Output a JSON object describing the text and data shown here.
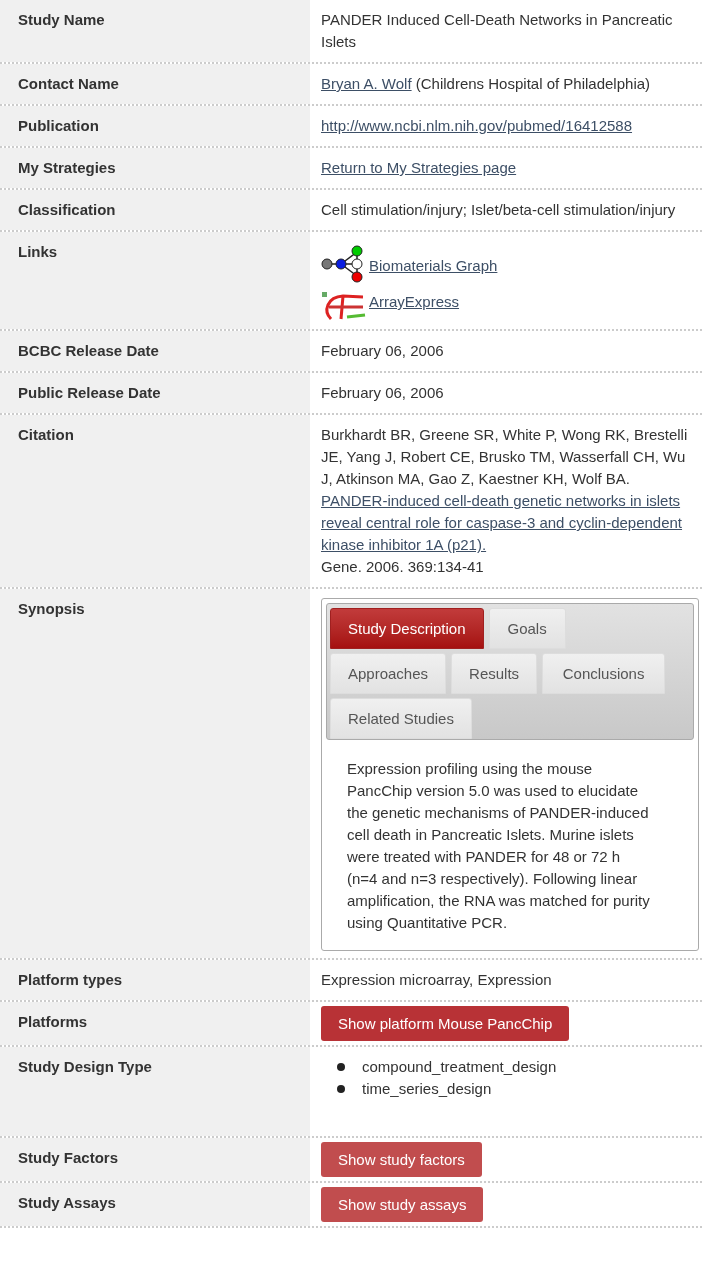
{
  "rows": [
    {
      "label": "Study Name",
      "kind": "text",
      "text": "PANDER Induced Cell-Death Networks in Pancreatic Islets"
    },
    {
      "label": "Contact Name",
      "kind": "contact",
      "link": "Bryan A. Wolf",
      "text": "(Childrens Hospital of Philadelphia)"
    },
    {
      "label": "Publication",
      "kind": "link",
      "link": "http://www.ncbi.nlm.nih.gov/pubmed/16412588"
    },
    {
      "label": "My Strategies",
      "kind": "link",
      "link": "Return to My Strategies page"
    },
    {
      "label": "Classification",
      "kind": "text",
      "text": "Cell stimulation/injury; Islet/beta-cell stimulation/injury"
    },
    {
      "label": "Links",
      "kind": "links",
      "items": [
        "Biomaterials Graph",
        "ArrayExpress"
      ]
    },
    {
      "label": "BCBC Release Date",
      "kind": "text",
      "text": "February 06, 2006"
    },
    {
      "label": "Public Release Date",
      "kind": "text",
      "text": "February 06, 2006"
    },
    {
      "label": "Citation",
      "kind": "citation",
      "before": "Burkhardt BR, Greene SR, White P, Wong RK, Brestelli JE, Yang J, Robert CE, Brusko TM, Wasserfall CH, Wu J, Atkinson MA, Gao Z, Kaestner KH, Wolf BA.",
      "link": "PANDER-induced cell-death genetic networks in islets reveal central role for caspase-3 and cyclin-dependent kinase inhibitor 1A (p21).",
      "after": "Gene. 2006. 369:134-41"
    },
    {
      "label": "Synopsis",
      "kind": "tabs",
      "tabs": [
        {
          "label": "Study Description",
          "selected": true
        },
        {
          "label": "Goals",
          "selected": false
        },
        {
          "label": "Approaches",
          "selected": false
        },
        {
          "label": "Results",
          "selected": false
        },
        {
          "label": "Conclusions",
          "selected": false
        },
        {
          "label": "Related Studies",
          "selected": false
        }
      ],
      "text": "Expression profiling using the mouse PancChip version 5.0 was used to elucidate the genetic mechanisms of PANDER-induced cell death in Pancreatic Islets. Murine islets were treated with PANDER for 48 or 72 h (n=4 and n=3 respectively). Following linear amplification, the RNA was matched for purity using Quantitative PCR."
    },
    {
      "label": "Platform types",
      "kind": "text",
      "text": "Expression microarray, Expression"
    },
    {
      "label": "Platforms",
      "kind": "button",
      "text": "Show platform Mouse PancChip",
      "primary": true
    },
    {
      "label": "Study Design Type",
      "kind": "list",
      "items": [
        "compound_treatment_design",
        "time_series_design"
      ]
    },
    {
      "label": "Study Factors",
      "kind": "button",
      "text": "Show study factors",
      "primary": false
    },
    {
      "label": "Study Assays",
      "kind": "button",
      "text": "Show study assays",
      "primary": false
    }
  ]
}
